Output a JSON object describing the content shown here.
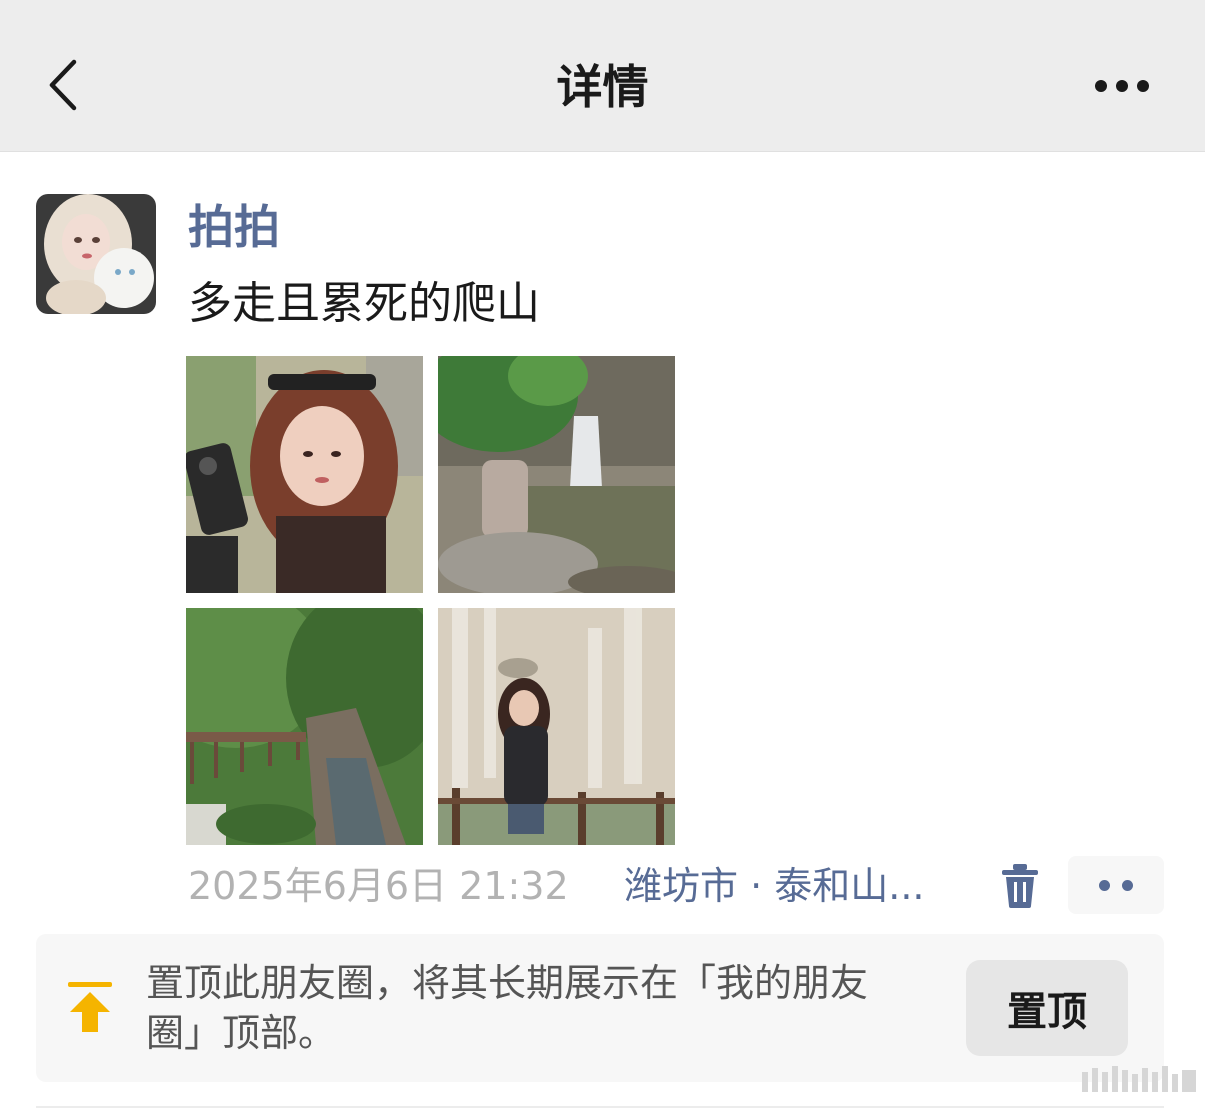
{
  "navbar": {
    "back_icon": "chevron-left-icon",
    "title": "详情",
    "more_icon": "ellipsis-icon"
  },
  "post": {
    "author": "拍拍",
    "text": "多走且累死的爬山",
    "photos": [
      "selfie-photo",
      "waterfall-rock-photo",
      "boardwalk-photo",
      "waterfall-portrait-photo"
    ],
    "time": "2025年6月6日 21:32",
    "location": "潍坊市 · 泰和山...",
    "delete_icon": "trash-icon",
    "action_icon": "two-dots-icon"
  },
  "pin_card": {
    "icon": "pin-to-top-icon",
    "description": "置顶此朋友圈，将其长期展示在「我的朋友圈」顶部。",
    "button_label": "置顶"
  },
  "colors": {
    "navbar_bg": "#ededed",
    "link_blue": "#576b95",
    "time_gray": "#b2b2b2",
    "pin_yellow": "#f5b400",
    "card_bg": "#f7f7f7"
  }
}
